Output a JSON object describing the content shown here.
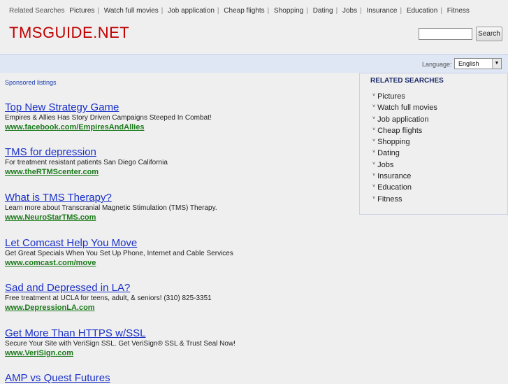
{
  "topbar": {
    "label": "Related Searches",
    "links": [
      "Pictures",
      "Watch full movies",
      "Job application",
      "Cheap flights",
      "Shopping",
      "Dating",
      "Jobs",
      "Insurance",
      "Education",
      "Fitness"
    ]
  },
  "logo": "TMSGUIDE.NET",
  "search": {
    "value": "",
    "button_label": "Search"
  },
  "language": {
    "label": "Language:",
    "selected": "English"
  },
  "sponsored_label": "Sponsored listings",
  "listings": [
    {
      "title": "Top New Strategy Game",
      "desc": "Empires & Allies Has Story Driven Campaigns Steeped In Combat!",
      "url": "www.facebook.com/EmpiresAndAllies"
    },
    {
      "title": "TMS for depression",
      "desc": "For treatment resistant patients San Diego California",
      "url": "www.theRTMScenter.com"
    },
    {
      "title": "What is TMS Therapy?",
      "desc": "Learn more about Transcranial Magnetic Stimulation (TMS) Therapy.",
      "url": "www.NeuroStarTMS.com"
    },
    {
      "title": "Let Comcast Help You Move",
      "desc": "Get Great Specials When You Set Up Phone, Internet and Cable Services",
      "url": "www.comcast.com/move"
    },
    {
      "title": "Sad and Depressed in LA?",
      "desc": "Free treatment at UCLA for teens, adult, & seniors! (310) 825-3351",
      "url": "www.DepressionLA.com"
    },
    {
      "title": "Get More Than HTTPS w/SSL",
      "desc": "Secure Your Site with VeriSign SSL. Get VeriSign® SSL & Trust Seal Now!",
      "url": "www.VeriSign.com"
    },
    {
      "title": "AMP vs Quest Futures"
    }
  ],
  "related": {
    "title": "RELATED SEARCHES",
    "items": [
      "Pictures",
      "Watch full movies",
      "Job application",
      "Cheap flights",
      "Shopping",
      "Dating",
      "Jobs",
      "Insurance",
      "Education",
      "Fitness"
    ]
  }
}
